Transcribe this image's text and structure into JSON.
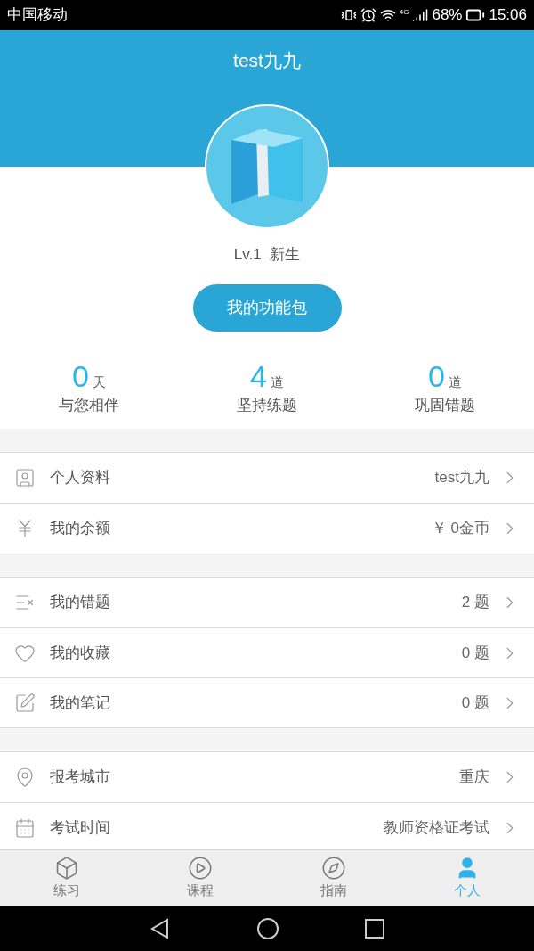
{
  "status_bar": {
    "carrier": "中国移动",
    "network": "4G",
    "battery": "68%",
    "time": "15:06"
  },
  "header": {
    "title": "test九九"
  },
  "profile": {
    "level": "Lv.1  新生",
    "button": "我的功能包"
  },
  "stats": [
    {
      "value": "0",
      "unit": "天",
      "label": "与您相伴"
    },
    {
      "value": "4",
      "unit": "道",
      "label": "坚持练题"
    },
    {
      "value": "0",
      "unit": "道",
      "label": "巩固错题"
    }
  ],
  "groups": [
    {
      "rows": [
        {
          "label": "个人资料",
          "value": "test九九"
        },
        {
          "label": "我的余额",
          "value": "￥ 0金币"
        }
      ]
    },
    {
      "rows": [
        {
          "label": "我的错题",
          "value": "2 题"
        },
        {
          "label": "我的收藏",
          "value": "0 题"
        },
        {
          "label": "我的笔记",
          "value": "0 题"
        }
      ]
    },
    {
      "rows": [
        {
          "label": "报考城市",
          "value": "重庆"
        },
        {
          "label": "考试时间",
          "value": "教师资格证考试"
        }
      ]
    }
  ],
  "tabs": [
    {
      "label": "练习",
      "selected": false
    },
    {
      "label": "课程",
      "selected": false
    },
    {
      "label": "指南",
      "selected": false
    },
    {
      "label": "个人",
      "selected": true
    }
  ]
}
